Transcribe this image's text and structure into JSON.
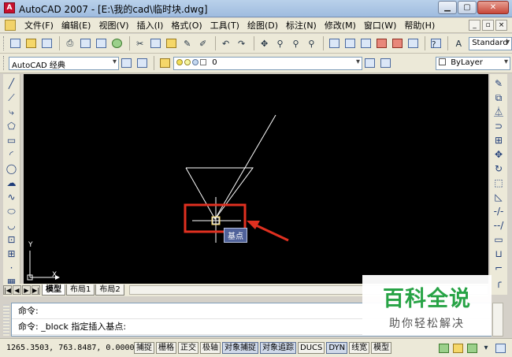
{
  "window": {
    "title": "AutoCAD 2007 - [E:\\我的cad\\临时块.dwg]",
    "app_icon_text": "A",
    "controls": [
      "minimize",
      "maximize",
      "close"
    ]
  },
  "menubar": {
    "items": [
      "文件(F)",
      "编辑(E)",
      "视图(V)",
      "插入(I)",
      "格式(O)",
      "工具(T)",
      "绘图(D)",
      "标注(N)",
      "修改(M)",
      "窗口(W)",
      "帮助(H)"
    ],
    "doc_controls": [
      "_",
      "▫",
      "×"
    ]
  },
  "toolbar_standard": {
    "text_style": "Standard"
  },
  "toolbar_layers": {
    "workspace": "AutoCAD 经典",
    "layer": "0",
    "color": "ByLayer"
  },
  "canvas": {
    "tooltip": "基点",
    "ucs_x": "X",
    "ucs_y": "Y",
    "background": "#000000",
    "highlight_color": "#e03020"
  },
  "layout_tabs": {
    "nav": [
      "|◀",
      "◀",
      "▶",
      "▶|"
    ],
    "tabs": [
      "模型",
      "布局1",
      "布局2"
    ],
    "active": "模型"
  },
  "command": {
    "history": "命令:",
    "current": "命令: _block 指定插入基点:"
  },
  "statusbar": {
    "coords": "1265.3503, 763.8487, 0.0000",
    "toggles": [
      "捕捉",
      "栅格",
      "正交",
      "极轴",
      "对象捕捉",
      "对象追踪",
      "DUCS",
      "DYN",
      "线宽",
      "模型"
    ]
  },
  "watermark": {
    "main": "百科全说",
    "sub": "助你轻松解决"
  }
}
